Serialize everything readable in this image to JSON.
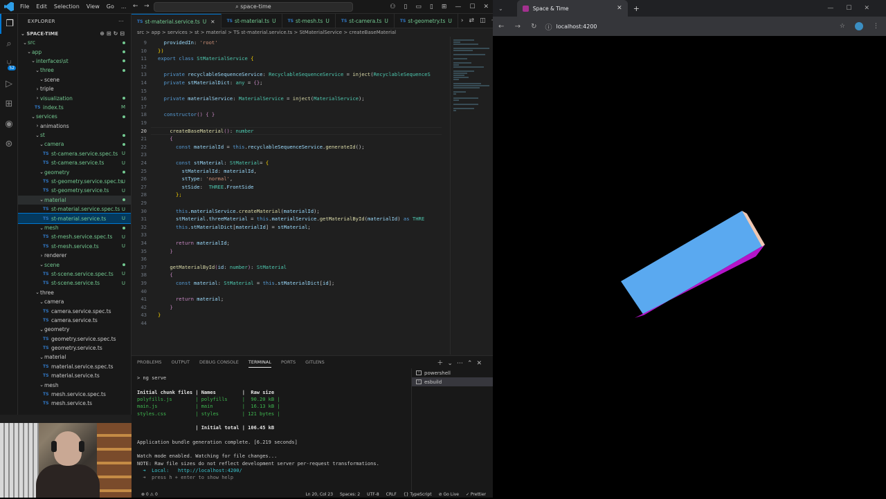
{
  "vscode": {
    "menu": [
      "File",
      "Edit",
      "Selection",
      "View",
      "Go",
      "..."
    ],
    "search": "space-time",
    "explorer_title": "EXPLORER",
    "project": "SPACE-TIME",
    "tree": [
      {
        "label": "src",
        "depth": 1,
        "type": "folder",
        "open": true,
        "status": "dot"
      },
      {
        "label": "app",
        "depth": 2,
        "type": "folder",
        "open": true,
        "status": "dot"
      },
      {
        "label": "interfaces\\st",
        "depth": 3,
        "type": "folder",
        "open": true,
        "status": "dot"
      },
      {
        "label": "three",
        "depth": 4,
        "type": "folder",
        "open": true,
        "status": "dot"
      },
      {
        "label": "scene",
        "depth": 5,
        "type": "folder",
        "open": true,
        "status": ""
      },
      {
        "label": "triple",
        "depth": 4,
        "type": "folder",
        "open": false,
        "status": ""
      },
      {
        "label": "visualization",
        "depth": 4,
        "type": "folder",
        "open": false,
        "status": "dot"
      },
      {
        "label": "index.ts",
        "depth": 4,
        "type": "file",
        "status": "M"
      },
      {
        "label": "services",
        "depth": 3,
        "type": "folder",
        "open": true,
        "status": "dot"
      },
      {
        "label": "animations",
        "depth": 4,
        "type": "folder",
        "open": false,
        "status": ""
      },
      {
        "label": "st",
        "depth": 4,
        "type": "folder",
        "open": true,
        "status": "dot"
      },
      {
        "label": "camera",
        "depth": 5,
        "type": "folder",
        "open": true,
        "status": "dot"
      },
      {
        "label": "st-camera.service.spec.ts",
        "depth": 6,
        "type": "file",
        "status": "U"
      },
      {
        "label": "st-camera.service.ts",
        "depth": 6,
        "type": "file",
        "status": "U"
      },
      {
        "label": "geometry",
        "depth": 5,
        "type": "folder",
        "open": true,
        "status": "dot"
      },
      {
        "label": "st-geometry.service.spec.ts",
        "depth": 6,
        "type": "file",
        "status": "U"
      },
      {
        "label": "st-geometry.service.ts",
        "depth": 6,
        "type": "file",
        "status": "U"
      },
      {
        "label": "material",
        "depth": 5,
        "type": "folder",
        "open": true,
        "status": "dot",
        "hover": true
      },
      {
        "label": "st-material.service.spec.ts",
        "depth": 6,
        "type": "file",
        "status": "U"
      },
      {
        "label": "st-material.service.ts",
        "depth": 6,
        "type": "file",
        "status": "U",
        "selected": true
      },
      {
        "label": "mesh",
        "depth": 5,
        "type": "folder",
        "open": true,
        "status": "dot"
      },
      {
        "label": "st-mesh.service.spec.ts",
        "depth": 6,
        "type": "file",
        "status": "U"
      },
      {
        "label": "st-mesh.service.ts",
        "depth": 6,
        "type": "file",
        "status": "U"
      },
      {
        "label": "renderer",
        "depth": 5,
        "type": "folder",
        "open": false,
        "status": ""
      },
      {
        "label": "scene",
        "depth": 5,
        "type": "folder",
        "open": true,
        "status": "dot"
      },
      {
        "label": "st-scene.service.spec.ts",
        "depth": 6,
        "type": "file",
        "status": "U"
      },
      {
        "label": "st-scene.service.ts",
        "depth": 6,
        "type": "file",
        "status": "U"
      },
      {
        "label": "three",
        "depth": 4,
        "type": "folder",
        "open": true,
        "status": ""
      },
      {
        "label": "camera",
        "depth": 5,
        "type": "folder",
        "open": true,
        "status": ""
      },
      {
        "label": "camera.service.spec.ts",
        "depth": 6,
        "type": "file",
        "status": ""
      },
      {
        "label": "camera.service.ts",
        "depth": 6,
        "type": "file",
        "status": ""
      },
      {
        "label": "geometry",
        "depth": 5,
        "type": "folder",
        "open": true,
        "status": ""
      },
      {
        "label": "geometry.service.spec.ts",
        "depth": 6,
        "type": "file",
        "status": ""
      },
      {
        "label": "geometry.service.ts",
        "depth": 6,
        "type": "file",
        "status": ""
      },
      {
        "label": "material",
        "depth": 5,
        "type": "folder",
        "open": true,
        "status": ""
      },
      {
        "label": "material.service.spec.ts",
        "depth": 6,
        "type": "file",
        "status": ""
      },
      {
        "label": "material.service.ts",
        "depth": 6,
        "type": "file",
        "status": ""
      },
      {
        "label": "mesh",
        "depth": 5,
        "type": "folder",
        "open": true,
        "status": ""
      },
      {
        "label": "mesh.service.spec.ts",
        "depth": 6,
        "type": "file",
        "status": ""
      },
      {
        "label": "mesh.service.ts",
        "depth": 6,
        "type": "file",
        "status": ""
      }
    ],
    "tabs": [
      {
        "label": "st-material.service.ts",
        "status": "U",
        "active": true
      },
      {
        "label": "st-material.ts",
        "status": "U"
      },
      {
        "label": "st-mesh.ts",
        "status": "U"
      },
      {
        "label": "st-camera.ts",
        "status": "U"
      },
      {
        "label": "st-geometry.ts",
        "status": "U"
      }
    ],
    "breadcrumb": "src > app > services > st > material > TS st-material.service.ts > StMaterialService > createBaseMaterial",
    "current_line": 20,
    "code": [
      {
        "n": 9,
        "html": "  <span class=\"vr\">providedIn</span>: <span class=\"sr\">'root'</span>"
      },
      {
        "n": 10,
        "html": "<span class=\"br\">})</span>"
      },
      {
        "n": 11,
        "html": "<span class=\"kw\">export class</span> <span class=\"ty\">StMaterialService</span> <span class=\"br\">{</span>"
      },
      {
        "n": 12,
        "html": ""
      },
      {
        "n": 13,
        "html": "  <span class=\"kw\">private</span> <span class=\"vr\">recyclableSequenceService</span>: <span class=\"ty\">RecyclableSequenceService</span> = <span class=\"fn\">inject</span>(<span class=\"ty\">RecyclableSequenceS</span>"
      },
      {
        "n": 14,
        "html": "  <span class=\"kw\">private</span> <span class=\"vr\">stMaterialDict</span>: <span class=\"ty\">any</span> = <span class=\"kc\">{}</span>;"
      },
      {
        "n": 15,
        "html": ""
      },
      {
        "n": 16,
        "html": "  <span class=\"kw\">private</span> <span class=\"vr\">materialService</span>: <span class=\"ty\">MaterialService</span> = <span class=\"fn\">inject</span>(<span class=\"ty\">MaterialService</span>);"
      },
      {
        "n": 17,
        "html": ""
      },
      {
        "n": 18,
        "html": "  <span class=\"kw\">constructor</span><span class=\"kc\">()</span> <span class=\"kc\">{ }</span>"
      },
      {
        "n": 19,
        "html": ""
      },
      {
        "n": 20,
        "html": "    <span class=\"fn\">createBaseMaterial</span><span class=\"kc\">()</span>: <span class=\"ty\">number</span>"
      },
      {
        "n": 21,
        "html": "    <span class=\"kc\">{</span>"
      },
      {
        "n": 22,
        "html": "      <span class=\"kw\">const</span> <span class=\"vr\">materialId</span> = <span class=\"kw\">this</span>.<span class=\"vr\">recyclableSequenceService</span>.<span class=\"fn\">generateId</span>();"
      },
      {
        "n": 23,
        "html": ""
      },
      {
        "n": 24,
        "html": "      <span class=\"kw\">const</span> <span class=\"vr\">stMaterial</span>: <span class=\"ty\">StMaterial</span>= <span class=\"br\">{</span>"
      },
      {
        "n": 25,
        "html": "        <span class=\"vr\">stMaterialId</span>: <span class=\"vr\">materialId</span>,"
      },
      {
        "n": 26,
        "html": "        <span class=\"vr\">stType</span>: <span class=\"sr\">'normal'</span>,"
      },
      {
        "n": 27,
        "html": "        <span class=\"vr\">stSide</span>:  <span class=\"ty\">THREE</span>.<span class=\"vr\">FrontSide</span>"
      },
      {
        "n": 28,
        "html": "      <span class=\"br\">};</span>"
      },
      {
        "n": 29,
        "html": ""
      },
      {
        "n": 30,
        "html": "      <span class=\"kw\">this</span>.<span class=\"vr\">materialService</span>.<span class=\"fn\">createMaterial</span>(<span class=\"vr\">materialId</span>);"
      },
      {
        "n": 31,
        "html": "      <span class=\"vr\">stMaterial</span>.<span class=\"vr\">threeMaterial</span> = <span class=\"kw\">this</span>.<span class=\"vr\">materialService</span>.<span class=\"fn\">getMaterialById</span>(<span class=\"vr\">materialId</span>) <span class=\"kw\">as</span> <span class=\"ty\">THRE</span>"
      },
      {
        "n": 32,
        "html": "      <span class=\"kw\">this</span>.<span class=\"vr\">stMaterialDict</span>[<span class=\"vr\">materialId</span>] = <span class=\"vr\">stMaterial</span>;"
      },
      {
        "n": 33,
        "html": ""
      },
      {
        "n": 34,
        "html": "      <span class=\"kc\">return</span> <span class=\"vr\">materialId</span>;"
      },
      {
        "n": 35,
        "html": "    <span class=\"kc\">}</span>"
      },
      {
        "n": 36,
        "html": ""
      },
      {
        "n": 37,
        "html": "    <span class=\"fn\">getMaterialById</span><span class=\"kc\">(</span><span class=\"vr\">id</span>: <span class=\"ty\">number</span><span class=\"kc\">)</span>: <span class=\"ty\">StMaterial</span>"
      },
      {
        "n": 38,
        "html": "    <span class=\"kc\">{</span>"
      },
      {
        "n": 39,
        "html": "      <span class=\"kw\">const</span> <span class=\"vr\">material</span>: <span class=\"ty\">StMaterial</span> = <span class=\"kw\">this</span>.<span class=\"vr\">stMaterialDict</span>[<span class=\"vr\">id</span>];"
      },
      {
        "n": 40,
        "html": ""
      },
      {
        "n": 41,
        "html": "      <span class=\"kc\">return</span> <span class=\"vr\">material</span>;"
      },
      {
        "n": 42,
        "html": "    <span class=\"kc\">}</span>"
      },
      {
        "n": 43,
        "html": "<span class=\"br\">}</span>"
      },
      {
        "n": 44,
        "html": ""
      }
    ],
    "panel_tabs": [
      "PROBLEMS",
      "OUTPUT",
      "DEBUG CONSOLE",
      "TERMINAL",
      "PORTS",
      "GITLENS"
    ],
    "panel_active": "TERMINAL",
    "terminal": [
      {
        "cls": "",
        "text": "> ng serve"
      },
      {
        "cls": "",
        "text": ""
      },
      {
        "cls": "b",
        "text": "Initial chunk files | Names         |  Raw size"
      },
      {
        "cls": "g",
        "text": "polyfills.js        | polyfills     |  90.20 kB |"
      },
      {
        "cls": "g",
        "text": "main.js             | main          |  16.13 kB |"
      },
      {
        "cls": "g",
        "text": "styles.css          | styles        | 121 bytes |"
      },
      {
        "cls": "",
        "text": ""
      },
      {
        "cls": "b",
        "text": "                    | Initial total | 106.45 kB"
      },
      {
        "cls": "",
        "text": ""
      },
      {
        "cls": "",
        "text": "Application bundle generation complete. [6.219 seconds]"
      },
      {
        "cls": "",
        "text": ""
      },
      {
        "cls": "",
        "text": "Watch mode enabled. Watching for file changes..."
      },
      {
        "cls": "",
        "text": "NOTE: Raw file sizes do not reflect development server per-request transformations."
      },
      {
        "cls": "c",
        "text": "  ➜  Local:   http://localhost:4200/"
      },
      {
        "cls": "dim",
        "text": "  ➜  press h + enter to show help"
      }
    ],
    "terminals": [
      {
        "label": "powershell",
        "active": false
      },
      {
        "label": "esbuild",
        "active": true
      }
    ],
    "status": [
      "⊗ 0 ⚠ 0",
      "Ln 20, Col 23",
      "Spaces: 2",
      "UTF-8",
      "CRLF",
      "{} TypeScript",
      "⊘ Go Live",
      "✓ Prettier"
    ]
  },
  "browser": {
    "tab_title": "Space & Time",
    "url": "localhost:4200",
    "box_top_color": "#5aa9f0",
    "box_side_color": "#b514c9",
    "box_end_color": "#f0c7b2"
  }
}
